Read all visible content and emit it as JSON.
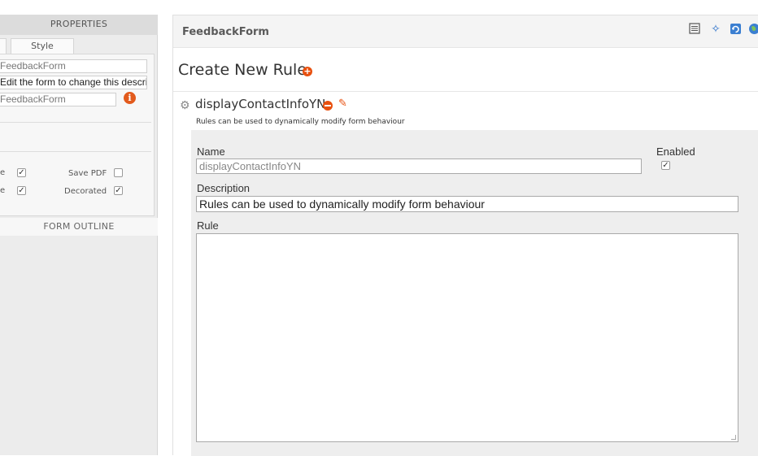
{
  "properties_panel": {
    "header": "PROPERTIES",
    "style_tab": "Style",
    "fields": {
      "name_value": "FeedbackForm",
      "description_value": "Edit the form to change this descri",
      "title_value": "FeedbackForm"
    },
    "checkbox_rows": [
      {
        "left_label_fragment": "e",
        "left_checked": true,
        "right_label": "Save PDF",
        "right_checked": false
      },
      {
        "left_label_fragment": "e",
        "left_checked": true,
        "right_label": "Decorated",
        "right_checked": true
      }
    ],
    "outline_header": "FORM OUTLINE"
  },
  "editor": {
    "form_title": "FeedbackForm",
    "page_heading": "Create New Rule",
    "rule": {
      "name": "displayContactInfoYN",
      "summary": "Rules can be used to dynamically modify form behaviour",
      "labels": {
        "name": "Name",
        "enabled": "Enabled",
        "description": "Description",
        "rule": "Rule"
      },
      "name_value": "displayContactInfoYN",
      "enabled": true,
      "description_value": "Rules can be used to dynamically modify form behaviour",
      "rule_value": ""
    }
  },
  "colors": {
    "accent_orange": "#e8500f",
    "icon_blue": "#2a6fc9"
  },
  "icons": [
    "info-icon",
    "list-icon",
    "run-icon",
    "refresh-icon",
    "globe-icon",
    "add-circle-icon",
    "gear-icon",
    "remove-circle-icon",
    "pencil-icon"
  ]
}
